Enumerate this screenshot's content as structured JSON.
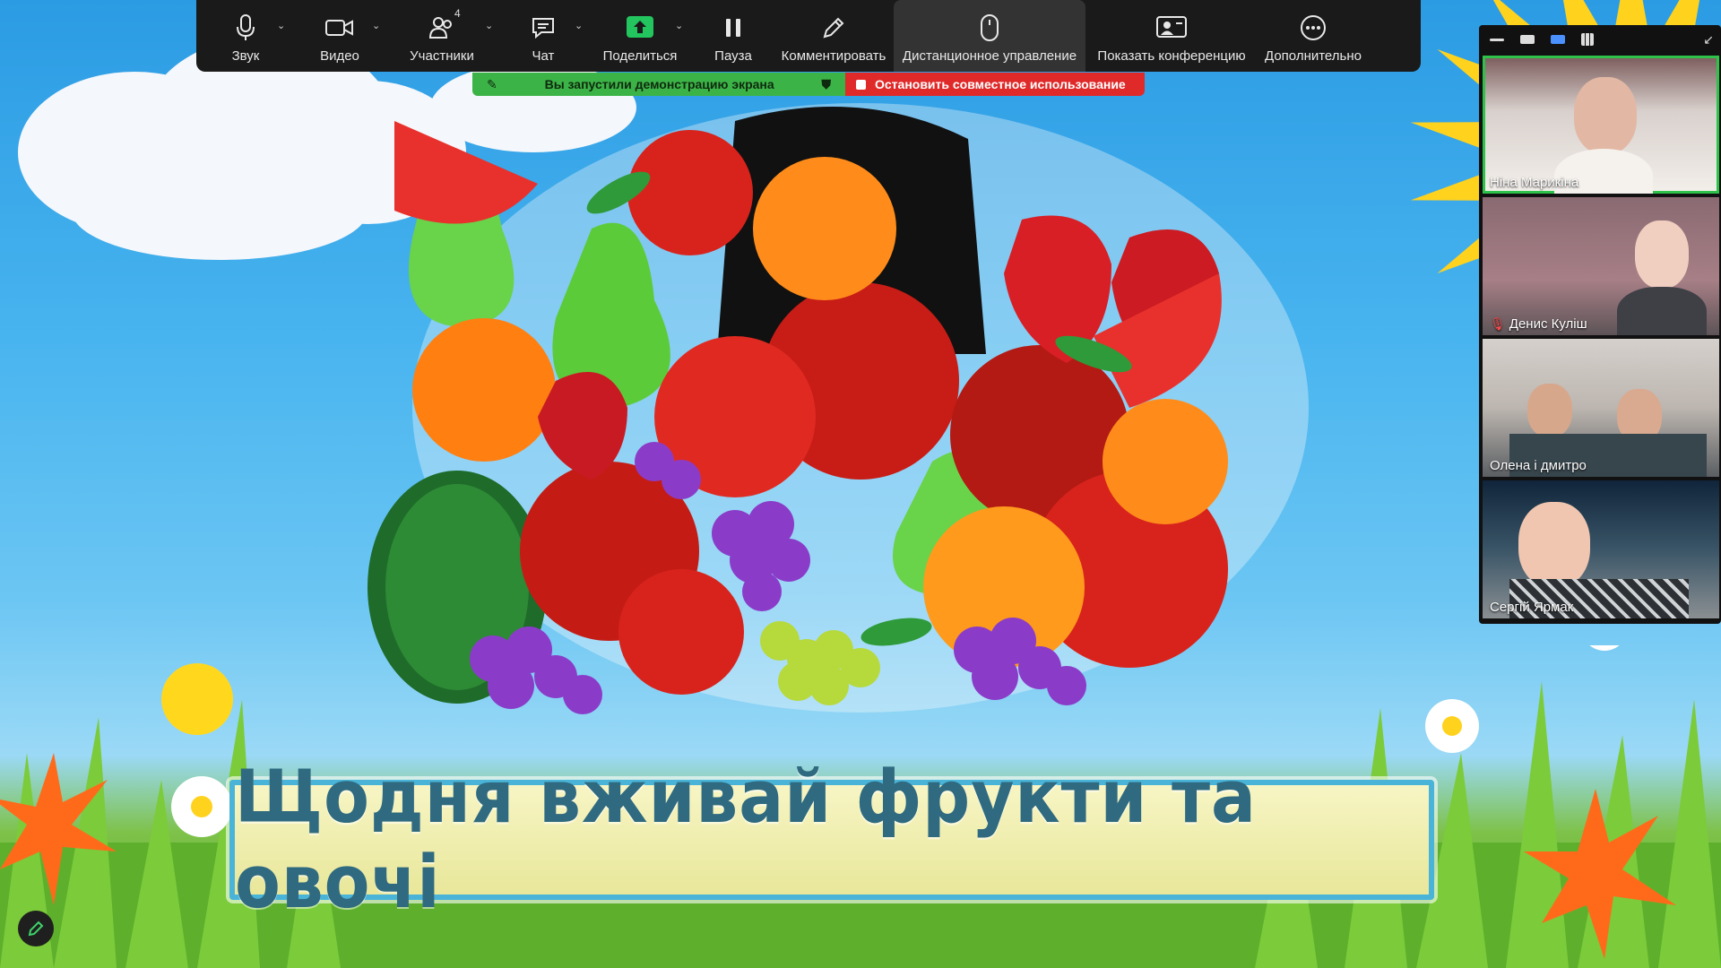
{
  "toolbar": {
    "audio": "Звук",
    "video": "Видео",
    "participants": "Участники",
    "participants_count": "4",
    "chat": "Чат",
    "share": "Поделиться",
    "pause": "Пауза",
    "annotate": "Комментировать",
    "remote_control": "Дистанционное управление",
    "show_meeting": "Показать конференцию",
    "more": "Дополнительно"
  },
  "share_bar": {
    "status": "Вы запустили демонстрацию экрана",
    "stop": "Остановить совместное использование"
  },
  "slide": {
    "banner_text": "Щодня вживай фрукти та овочі"
  },
  "participants": [
    {
      "name": "Ніна Марикіна",
      "speaking": true
    },
    {
      "name": "Денис Куліш",
      "muted": true
    },
    {
      "name": "Олена і дмитро"
    },
    {
      "name": "Сергій Ярмак"
    }
  ],
  "colors": {
    "toolbar_bg": "#1a1a1a",
    "share_green": "#3cb347",
    "stop_red": "#e02a2a",
    "speaker_outline": "#2fc24a"
  }
}
